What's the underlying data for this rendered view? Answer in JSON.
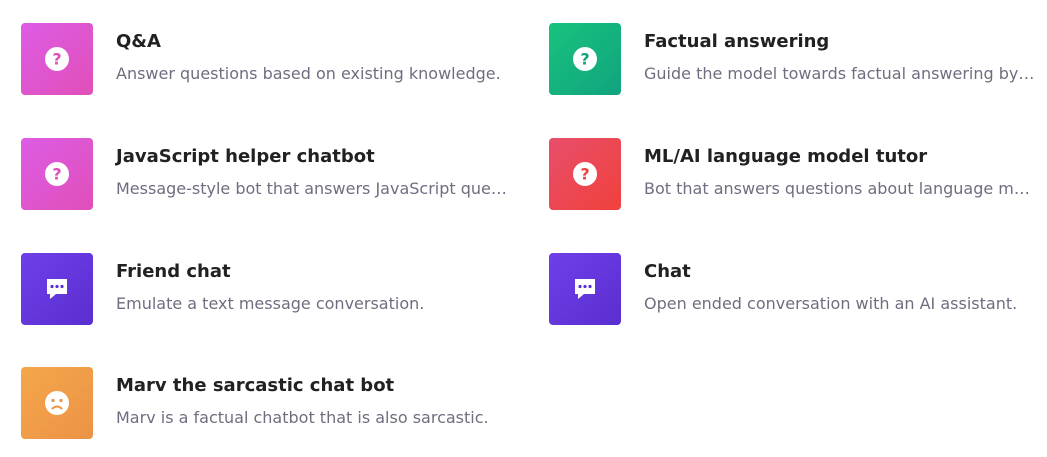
{
  "examples": {
    "qa": {
      "title": "Q&A",
      "description": "Answer questions based on existing knowledge.",
      "icon": "question-circle-icon",
      "colors": [
        "#dd5ce5",
        "#e04fb8"
      ]
    },
    "factual": {
      "title": "Factual answering",
      "description": "Guide the model towards factual answering by showing it how to respond.",
      "icon": "question-circle-icon",
      "colors": [
        "#19c37d",
        "#10a37f"
      ]
    },
    "js_chatbot": {
      "title": "JavaScript helper chatbot",
      "description": "Message-style bot that answers JavaScript questions.",
      "icon": "question-circle-icon",
      "colors": [
        "#dd5ce5",
        "#e04fb8"
      ]
    },
    "tutor": {
      "title": "ML/AI language model tutor",
      "description": "Bot that answers questions about language models.",
      "icon": "question-circle-icon",
      "colors": [
        "#e84e6b",
        "#f0413c"
      ]
    },
    "friend_chat": {
      "title": "Friend chat",
      "description": "Emulate a text message conversation.",
      "icon": "chat-bubble-icon",
      "colors": [
        "#6e3fe8",
        "#5a2ed0"
      ]
    },
    "chat": {
      "title": "Chat",
      "description": "Open ended conversation with an AI assistant.",
      "icon": "chat-bubble-icon",
      "colors": [
        "#6e3fe8",
        "#5a2ed0"
      ]
    },
    "marv": {
      "title": "Marv the sarcastic chat bot",
      "description": "Marv is a factual chatbot that is also sarcastic.",
      "icon": "frown-face-icon",
      "colors": [
        "#f4a64a",
        "#ec9346"
      ]
    }
  }
}
